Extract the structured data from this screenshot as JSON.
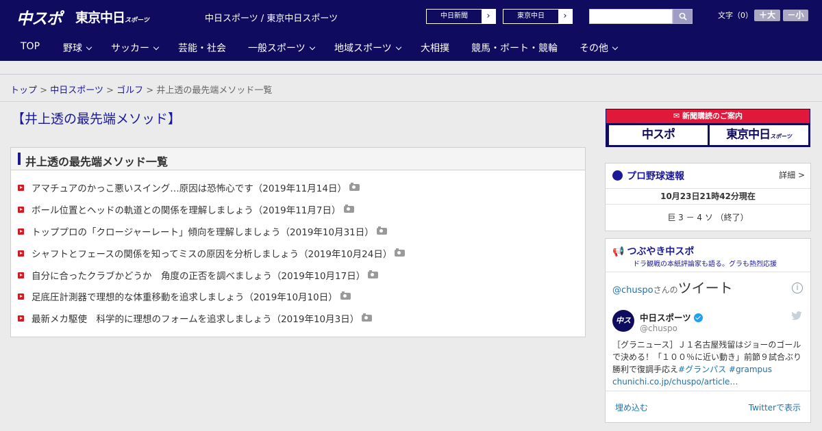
{
  "header": {
    "logo_main": "中スポ",
    "logo_tokyo": "東京中日",
    "logo_tokyo_small": "スポーツ",
    "site_name": "中日スポーツ / 東京中日スポーツ",
    "links": [
      "中日新聞",
      "東京中日"
    ],
    "search_placeholder": "",
    "font_label": "文字（0）",
    "font_larger": "＋大",
    "font_smaller": "－小"
  },
  "nav": [
    {
      "label": "TOP",
      "dropdown": false
    },
    {
      "label": "野球",
      "dropdown": true
    },
    {
      "label": "サッカー",
      "dropdown": true
    },
    {
      "label": "芸能・社会",
      "dropdown": false
    },
    {
      "label": "一般スポーツ",
      "dropdown": true
    },
    {
      "label": "地域スポーツ",
      "dropdown": true
    },
    {
      "label": "大相撲",
      "dropdown": false
    },
    {
      "label": "競馬・ボート・競輪",
      "dropdown": false
    },
    {
      "label": "その他",
      "dropdown": true
    }
  ],
  "breadcrumb": {
    "items": [
      "トップ",
      "中日スポーツ",
      "ゴルフ"
    ],
    "sep": ">",
    "current": "井上透の最先端メソッド一覧"
  },
  "page_title": "【井上透の最先端メソッド】",
  "list": {
    "heading": "井上透の最先端メソッド一覧",
    "items": [
      "アマチュアのかっこ悪いスイング…原因は恐怖心です（2019年11月14日）",
      "ボール位置とヘッドの軌道との関係を理解しましょう（2019年11月7日）",
      "トッププロの「クロージャーレート」傾向を理解しましょう（2019年10月31日）",
      "シャフトとフェースの関係を知ってミスの原因を分析しましょう（2019年10月24日）",
      "自分に合ったクラブかどうか　角度の正否を調べましょう（2019年10月17日）",
      "足底圧計測器で理想的な体重移動を追求しましょう（2019年10月10日）",
      "最新メカ駆使　科学的に理想のフォームを追求しましょう（2019年10月3日）"
    ]
  },
  "subscribe": {
    "title": "新聞購読のご案内",
    "left": "中スポ",
    "right": "東京中日",
    "right_small": "スポーツ"
  },
  "baseball": {
    "title": "プロ野球速報",
    "detail": "詳細 >",
    "timestamp": "10月23日21時42分現在",
    "game": "巨 3 － 4 ソ （終了）"
  },
  "tweets": {
    "title": "つぶやき中スポ",
    "subtitle": "ドラ観戦の本紙評論家も語る。グラも熱烈応援",
    "handle_link": "@chuspo",
    "san": "さんの",
    "tweet_word": "ツイート",
    "user_name": "中日スポーツ",
    "user_handle": "@chuspo",
    "avatar_text": "中スポ",
    "text": "［グラニュース］Ｊ１名古屋残留はジョーのゴールで決める！「１００％に近い動き」前節９試合ぶり勝利で復調手応え",
    "hashtags": "#グランパス #grampus",
    "url": "chunichi.co.jp/chuspo/article…",
    "embed": "埋め込む",
    "view_on": "Twitterで表示"
  },
  "colors": {
    "navy": "#0f0c5f",
    "link_blue": "#1b1897",
    "red": "#d7181f"
  }
}
